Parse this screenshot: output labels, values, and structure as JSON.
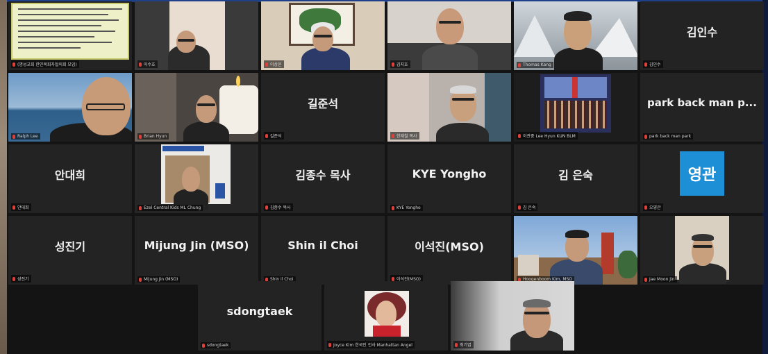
{
  "participants": [
    {
      "caption": "(명성교회 한인목회자협의회 모임)",
      "video": "document"
    },
    {
      "caption": "이수호",
      "video": "person"
    },
    {
      "caption": "이상윤",
      "video": "person"
    },
    {
      "caption": "김지호",
      "video": "person"
    },
    {
      "caption": "Thomas Kang",
      "video": "person"
    },
    {
      "name": "김인수",
      "caption": "김인수"
    },
    {
      "caption": "Ralph Lee",
      "video": "person"
    },
    {
      "caption": "Brian Hyun",
      "video": "person"
    },
    {
      "name": "길준석",
      "caption": "길준석"
    },
    {
      "caption": "한재철 목사",
      "video": "person"
    },
    {
      "caption": "이관중 Lee Hyun KUN BLM",
      "video": "group"
    },
    {
      "name": "park back man p...",
      "caption": "park back man park"
    },
    {
      "name": "안대희",
      "caption": "안대희"
    },
    {
      "caption": "Ezel Central Kids ML Chung",
      "video": "person"
    },
    {
      "name": "김종수 목사",
      "caption": "김종수 목사"
    },
    {
      "name": "KYE Yongho",
      "caption": "KYE Yongho"
    },
    {
      "name": "김 은숙",
      "caption": "김 은숙"
    },
    {
      "name": "영관",
      "caption": "오영관"
    },
    {
      "name": "성진기",
      "caption": "성진기"
    },
    {
      "name": "Mijung Jin (MSO)",
      "caption": "Mijung Jin (MSO)"
    },
    {
      "name": "Shin il Choi",
      "caption": "Shin il Choi"
    },
    {
      "name": "이석진(MSO)",
      "caption": "이석진(MSO)"
    },
    {
      "caption": "Hoogenboom Kim, MSO",
      "video": "person"
    },
    {
      "caption": "Jae Moon Jin",
      "video": "person"
    },
    {
      "name": "sdongtaek",
      "caption": "sdongtaek"
    },
    {
      "caption": "Joyce Kim 한국인 전사 Manhattan Angel",
      "video": "person"
    },
    {
      "caption": "최기엽",
      "video": "person"
    }
  ],
  "colors": {
    "tile_bg": "#232323",
    "name_text": "#f2f2f2",
    "muted_mic": "#e0403a",
    "yg_badge": "#1d8fd6"
  }
}
